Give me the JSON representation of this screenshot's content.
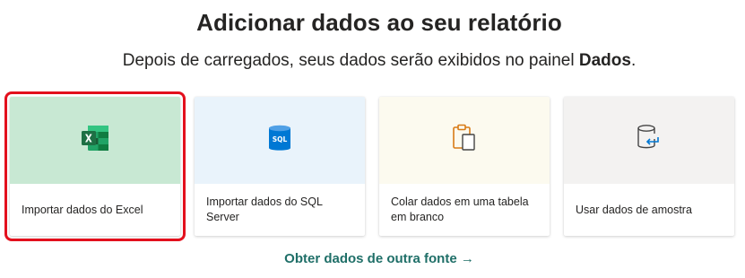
{
  "header": {
    "title": "Adicionar dados ao seu relatório",
    "subtitle_prefix": "Depois de carregados, seus dados serão exibidos no painel ",
    "subtitle_bold": "Dados",
    "subtitle_suffix": "."
  },
  "cards": [
    {
      "label": "Importar dados do Excel",
      "icon": "excel-icon",
      "bg": "#c8e8d3",
      "selected": true
    },
    {
      "label": "Importar dados do SQL Server",
      "icon": "sql-server-icon",
      "bg": "#e9f3fb",
      "selected": false
    },
    {
      "label": "Colar dados em uma tabela em branco",
      "icon": "clipboard-icon",
      "bg": "#fcfaef",
      "selected": false
    },
    {
      "label": "Usar dados de amostra",
      "icon": "database-icon",
      "bg": "#f3f2f1",
      "selected": false
    }
  ],
  "footer": {
    "link_label": "Obter dados de outra fonte →"
  },
  "colors": {
    "selection_border": "#e3101d",
    "link": "#1f6f68",
    "excel_green": "#1d7044"
  }
}
